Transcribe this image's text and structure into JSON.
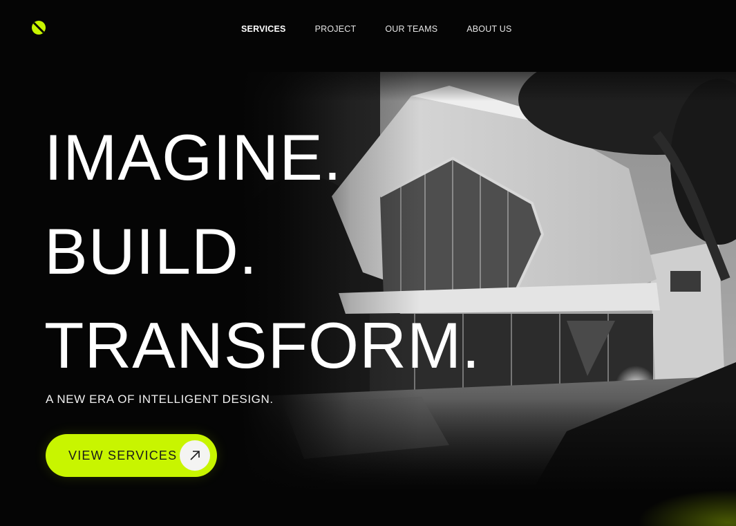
{
  "brand": {
    "logo_icon": "lime-slash-circle-icon",
    "accent_color": "#c8f500"
  },
  "nav": {
    "items": [
      {
        "label": "SERVICES",
        "active": true
      },
      {
        "label": "PROJECT",
        "active": false
      },
      {
        "label": "OUR TEAMS",
        "active": false
      },
      {
        "label": "ABOUT US",
        "active": false
      }
    ]
  },
  "hero": {
    "headline": [
      "IMAGINE.",
      "BUILD.",
      "TRANSFORM."
    ],
    "tagline": "A NEW ERA OF INTELLIGENT DESIGN.",
    "cta": {
      "label": "VIEW SERVICES",
      "icon": "arrow-up-right-icon"
    },
    "image": "modern-house-photo"
  },
  "colors": {
    "background": "#050505",
    "text": "#ffffff",
    "accent": "#c8f500"
  }
}
